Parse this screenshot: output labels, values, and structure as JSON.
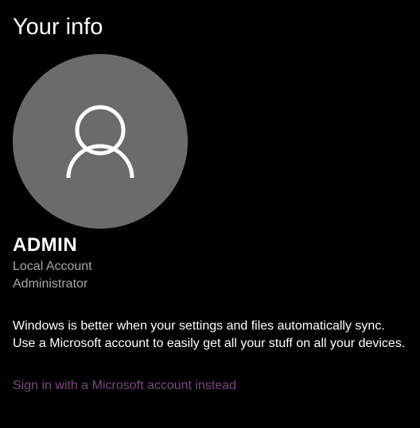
{
  "page": {
    "title": "Your info"
  },
  "user": {
    "avatar_icon": "person-icon",
    "name": "ADMIN",
    "account_type": "Local Account",
    "role": "Administrator"
  },
  "sync": {
    "message": "Windows is better when your settings and files automatically sync. Use a Microsoft account to easily get all your stuff on all your devices.",
    "link_label": "Sign in with a Microsoft account instead"
  },
  "colors": {
    "background": "#000000",
    "avatar_background": "#6b6b6b",
    "secondary_text": "#a6a6a6",
    "link": "#7a4a7e"
  }
}
